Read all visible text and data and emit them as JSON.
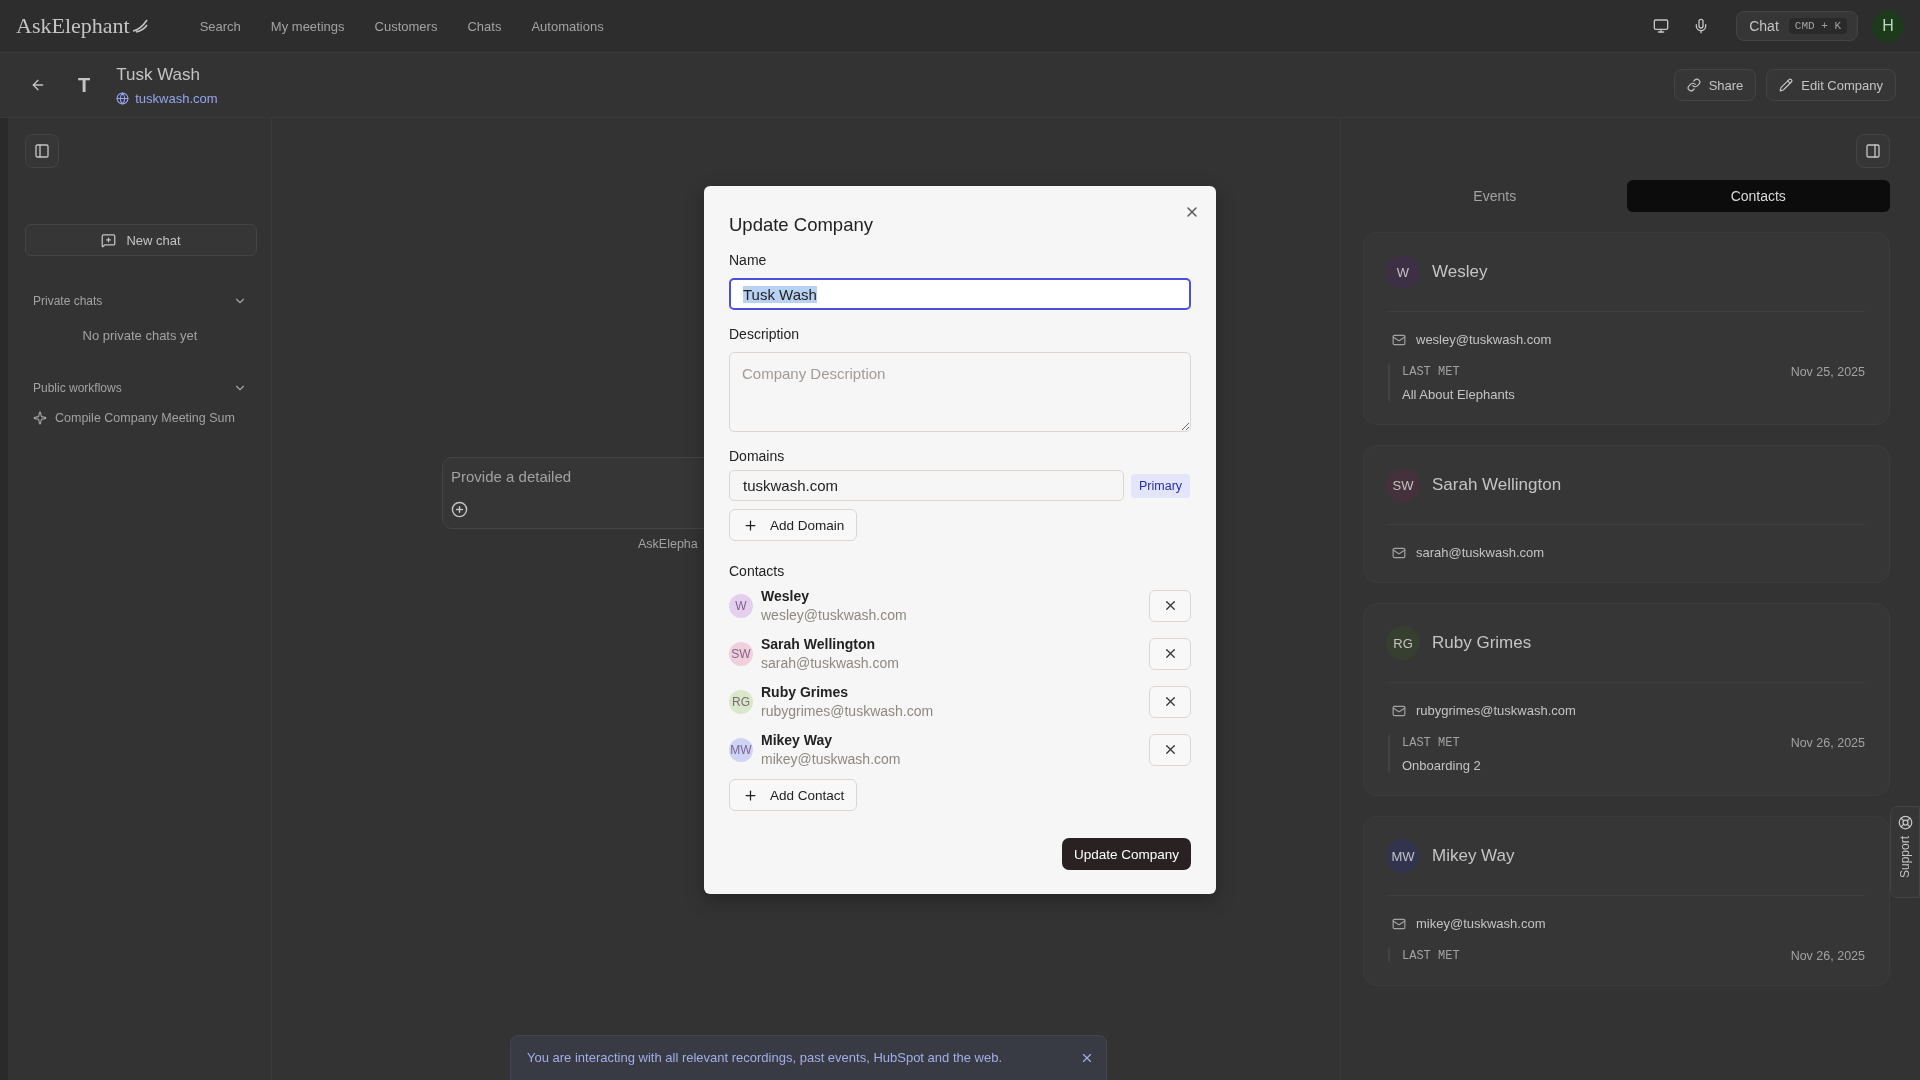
{
  "topbar": {
    "logo": "AskElephant",
    "nav": [
      {
        "label": "Search"
      },
      {
        "label": "My meetings"
      },
      {
        "label": "Customers"
      },
      {
        "label": "Chats"
      },
      {
        "label": "Automations"
      }
    ],
    "chat_button": {
      "label": "Chat",
      "shortcut": "CMD + K"
    },
    "avatar": "H"
  },
  "company": {
    "initial": "T",
    "name": "Tusk Wash",
    "domain": "tuskwash.com",
    "actions": [
      {
        "kind": "share",
        "label": "Share"
      },
      {
        "kind": "edit",
        "label": "Edit Company"
      }
    ]
  },
  "sidebar": {
    "new_chat": "New chat",
    "sections": [
      {
        "title": "Private chats",
        "expanded": true,
        "empty_text": "No private chats yet"
      },
      {
        "title": "Public workflows",
        "expanded": true,
        "items": [
          "Compile Company Meeting Sum"
        ]
      }
    ]
  },
  "chat": {
    "placeholder": "Provide a detailed",
    "footer": "AskElepha"
  },
  "banner": {
    "text": "You are interacting with all relevant recordings, past events, HubSpot and the web."
  },
  "right_panel": {
    "tabs": [
      {
        "label": "Events",
        "selected": false
      },
      {
        "label": "Contacts",
        "selected": true
      }
    ],
    "contacts": [
      {
        "initials": "W",
        "name": "Wesley",
        "color": "#3d3044",
        "email": "wesley@tuskwash.com",
        "last_met": {
          "label": "LAST MET",
          "date": "Nov 25, 2025",
          "title": "All About Elephants"
        }
      },
      {
        "initials": "SW",
        "name": "Sarah Wellington",
        "color": "#45313b",
        "email": "sarah@tuskwash.com"
      },
      {
        "initials": "RG",
        "name": "Ruby Grimes",
        "color": "#363f30",
        "email": "rubygrimes@tuskwash.com",
        "last_met": {
          "label": "LAST MET",
          "date": "Nov 26, 2025",
          "title": "Onboarding 2"
        }
      },
      {
        "initials": "MW",
        "name": "Mikey Way",
        "color": "#31344c",
        "email": "mikey@tuskwash.com",
        "last_met": {
          "label": "LAST MET",
          "date": "Nov 26, 2025"
        }
      }
    ]
  },
  "support": "Support",
  "modal": {
    "title": "Update Company",
    "name": {
      "label": "Name",
      "value": "Tusk Wash",
      "text_selected": true
    },
    "description": {
      "label": "Description",
      "placeholder": "Company Description"
    },
    "domains": {
      "label": "Domains",
      "items": [
        {
          "value": "tuskwash.com",
          "badge": "Primary"
        }
      ],
      "add": "Add Domain"
    },
    "contacts": {
      "label": "Contacts",
      "items": [
        {
          "initials": "W",
          "name": "Wesley",
          "email": "wesley@tuskwash.com",
          "color": "#e4d0ee"
        },
        {
          "initials": "SW",
          "name": "Sarah Wellington",
          "email": "sarah@tuskwash.com",
          "color": "#f0d0dc"
        },
        {
          "initials": "RG",
          "name": "Ruby Grimes",
          "email": "rubygrimes@tuskwash.com",
          "color": "#d8e8c8"
        },
        {
          "initials": "MW",
          "name": "Mikey Way",
          "email": "mikey@tuskwash.com",
          "color": "#d0d4f4"
        }
      ],
      "add": "Add Contact"
    },
    "submit": "Update Company"
  }
}
